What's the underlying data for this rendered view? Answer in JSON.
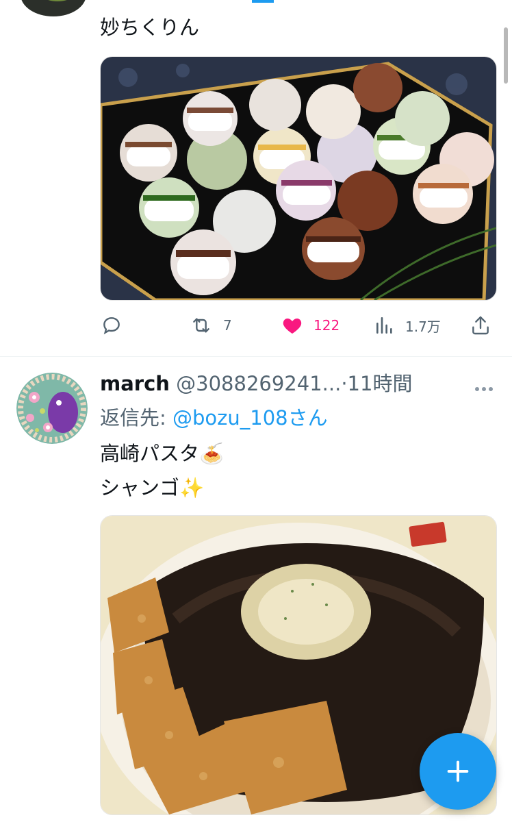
{
  "tweet1": {
    "text": "妙ちくりん",
    "retweets": "7",
    "likes": "122",
    "views": "1.7万"
  },
  "tweet2": {
    "display_name": "march",
    "handle": "@3088269241...",
    "time": "·11時間",
    "reply_prefix": "返信先:",
    "reply_to": "@bozu_108さん",
    "text_line1": "高崎パスタ",
    "text_line1_emoji": "🍝",
    "text_line2": "シャンゴ",
    "text_line2_emoji": "✨"
  },
  "colors": {
    "accent": "#1d9bf0",
    "like": "#f91880",
    "muted": "#536471"
  }
}
